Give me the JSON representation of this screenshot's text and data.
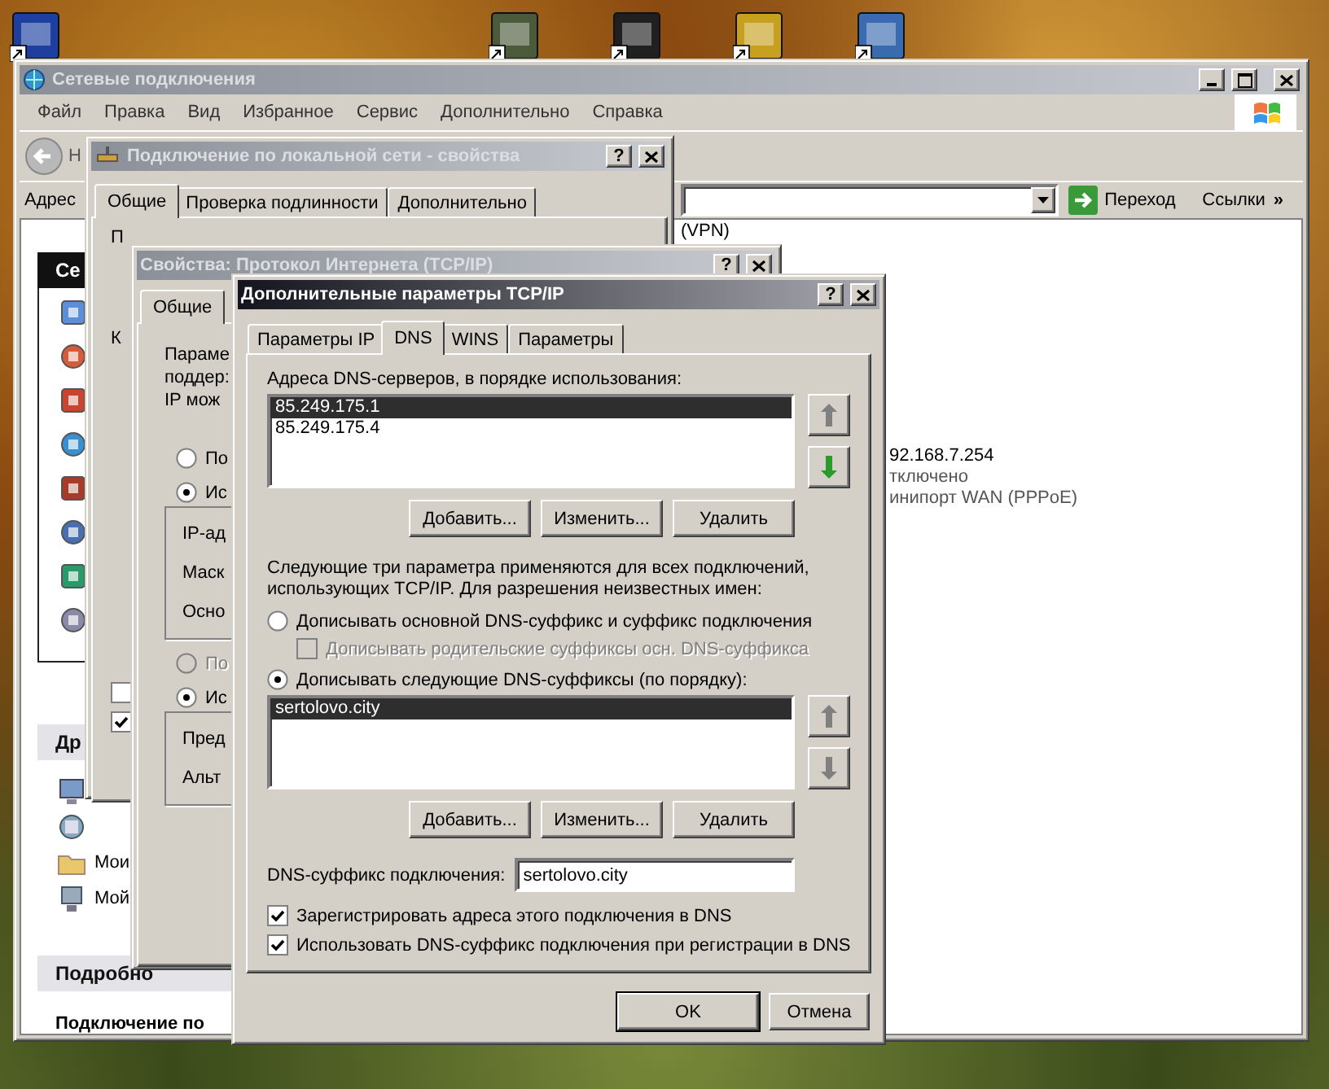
{
  "explorer": {
    "title": "Сетевые подключения",
    "active": false,
    "menu": [
      "Файл",
      "Правка",
      "Вид",
      "Избранное",
      "Сервис",
      "Дополнительно",
      "Справка"
    ],
    "back_label": "Н",
    "address_label": "Адрес",
    "go_button": "Переход",
    "links_label": "Ссылки",
    "links_chevron": "»",
    "task_pane": {
      "heading": "Се",
      "other_heading": "Др",
      "other_links": [
        "Мои",
        "Мой"
      ],
      "details_heading": "Подробно",
      "details_title": "Подключение по"
    },
    "content": {
      "vpn_group": "(VPN)",
      "lines": [
        "92.168.7.254",
        "тключено",
        "инипорт WAN (PPPoE)"
      ]
    }
  },
  "lan_properties": {
    "title": "Подключение по локальной сети - свойства",
    "active": false,
    "help": "?",
    "tabs": [
      {
        "label": "Общие",
        "selected": true
      },
      {
        "label": "Проверка подлинности",
        "selected": false
      },
      {
        "label": "Дополнительно",
        "selected": false
      }
    ],
    "labels": [
      "П",
      "К"
    ],
    "checkboxes": [
      {
        "checked": false
      },
      {
        "checked": true
      }
    ]
  },
  "tcpip_properties": {
    "title": "Свойства: Протокол Интернета (TCP/IP)",
    "active": false,
    "help": "?",
    "tabs": [
      {
        "label": "Общие",
        "selected": true
      }
    ],
    "intro_lines": [
      "Параме",
      "поддер:",
      "IP мож"
    ],
    "ip_radios": [
      {
        "label": "По",
        "selected": false,
        "disabled": false
      },
      {
        "label": "Ис",
        "selected": true,
        "disabled": false
      }
    ],
    "ip_fields": [
      "IP-ад",
      "Маск",
      "Осно"
    ],
    "dns_radios": [
      {
        "label": "По",
        "selected": false,
        "disabled": true
      },
      {
        "label": "Ис",
        "selected": true,
        "disabled": false
      }
    ],
    "dns_fields": [
      "Пред",
      "Альт"
    ]
  },
  "advanced_tcpip": {
    "title": "Дополнительные параметры TCP/IP",
    "active": true,
    "help": "?",
    "tabs": [
      {
        "label": "Параметры IP",
        "selected": false
      },
      {
        "label": "DNS",
        "selected": true
      },
      {
        "label": "WINS",
        "selected": false
      },
      {
        "label": "Параметры",
        "selected": false
      }
    ],
    "dns_servers": {
      "label": "Адреса DNS-серверов, в порядке использования:",
      "items": [
        {
          "text": "85.249.175.1",
          "selected": true
        },
        {
          "text": "85.249.175.4",
          "selected": false
        }
      ],
      "move_buttons": [
        {
          "disabled": true
        },
        {
          "disabled": false
        }
      ],
      "buttons": [
        "Добавить...",
        "Изменить...",
        "Удалить"
      ]
    },
    "note": "Следующие три параметра применяются для всех подключений, использующих TCP/IP. Для разрешения неизвестных имен:",
    "options": [
      {
        "kind": "radio",
        "label": "Дописывать основной DNS-суффикс и суффикс подключения",
        "selected": false,
        "disabled": false
      },
      {
        "kind": "checkbox",
        "label": "Дописывать родительские суффиксы осн. DNS-суффикса",
        "checked": false,
        "disabled": true
      },
      {
        "kind": "radio",
        "label": "Дописывать следующие DNS-суффиксы (по порядку):",
        "selected": true,
        "disabled": false
      }
    ],
    "suffixes": {
      "items": [
        {
          "text": "sertolovo.city",
          "selected": true
        }
      ],
      "move_buttons": [
        {
          "disabled": true
        },
        {
          "disabled": true
        }
      ],
      "buttons": [
        "Добавить...",
        "Изменить...",
        "Удалить"
      ]
    },
    "connection_suffix": {
      "label": "DNS-суффикс подключения:",
      "value": "sertolovo.city"
    },
    "checks": [
      {
        "label": "Зарегистрировать адреса этого подключения в DNS",
        "checked": true
      },
      {
        "label": "Использовать DNS-суффикс подключения при регистрации в DNS",
        "checked": true
      }
    ],
    "footer_buttons": [
      "OK",
      "Отмена"
    ]
  }
}
